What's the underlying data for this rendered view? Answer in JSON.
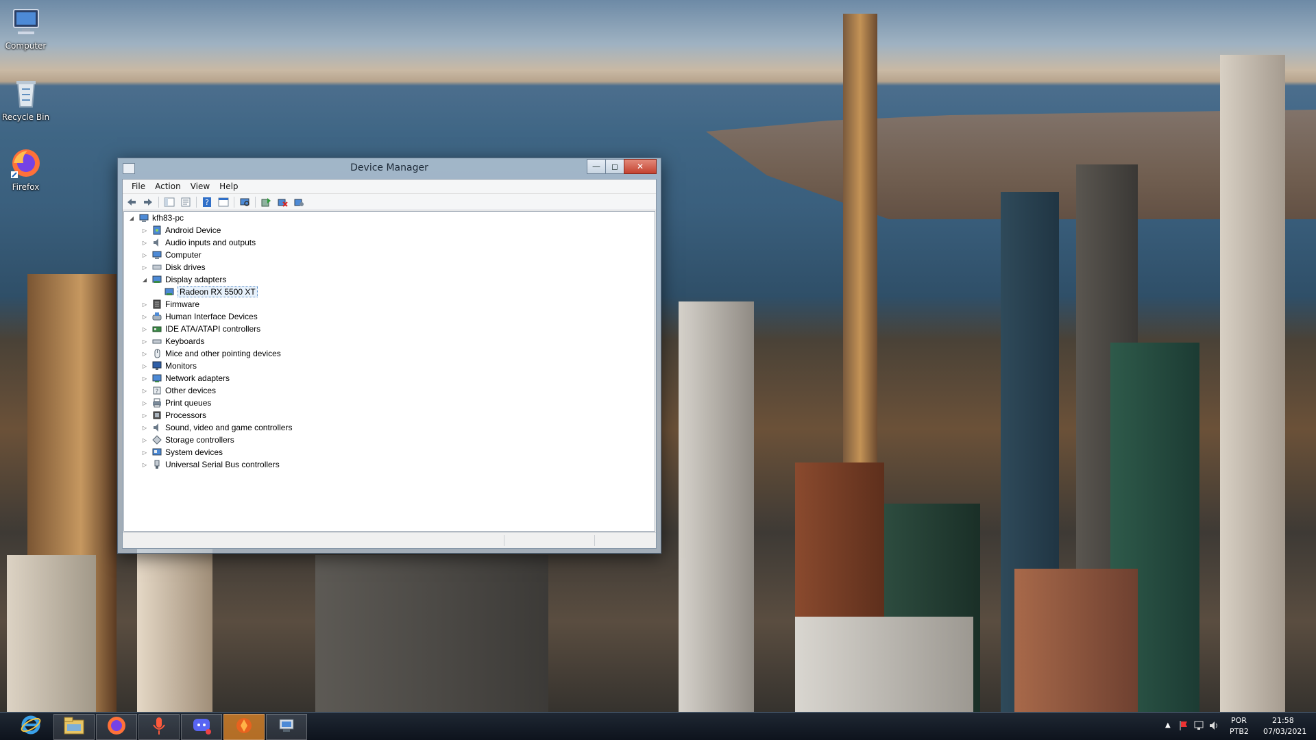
{
  "desktop": {
    "icons": [
      {
        "label": "Computer",
        "icon": "computer-icon"
      },
      {
        "label": "Recycle Bin",
        "icon": "recycle-bin-icon"
      },
      {
        "label": "Firefox",
        "icon": "firefox-icon"
      }
    ]
  },
  "window": {
    "title": "Device Manager",
    "menu": [
      "File",
      "Action",
      "View",
      "Help"
    ],
    "toolbar": [
      "back-icon",
      "forward-icon",
      "show-hide-console-tree-icon",
      "properties-icon",
      "help-icon",
      "show-details-icon",
      "scan-hardware-icon",
      "update-driver-icon",
      "uninstall-device-icon",
      "enable-device-icon"
    ],
    "tree": {
      "root": "kfh83-pc",
      "items": [
        {
          "label": "Android Device",
          "icon": "android-device-icon",
          "expanded": false
        },
        {
          "label": "Audio inputs and outputs",
          "icon": "speaker-icon",
          "expanded": false
        },
        {
          "label": "Computer",
          "icon": "computer-icon",
          "expanded": false
        },
        {
          "label": "Disk drives",
          "icon": "disk-drive-icon",
          "expanded": false
        },
        {
          "label": "Display adapters",
          "icon": "display-adapter-icon",
          "expanded": true
        },
        {
          "label": "Radeon RX 5500 XT",
          "icon": "display-adapter-icon",
          "child": true,
          "selected": true
        },
        {
          "label": "Firmware",
          "icon": "firmware-icon",
          "expanded": false
        },
        {
          "label": "Human Interface Devices",
          "icon": "hid-icon",
          "expanded": false
        },
        {
          "label": "IDE ATA/ATAPI controllers",
          "icon": "ide-controller-icon",
          "expanded": false
        },
        {
          "label": "Keyboards",
          "icon": "keyboard-icon",
          "expanded": false
        },
        {
          "label": "Mice and other pointing devices",
          "icon": "mouse-icon",
          "expanded": false
        },
        {
          "label": "Monitors",
          "icon": "monitor-icon",
          "expanded": false
        },
        {
          "label": "Network adapters",
          "icon": "network-adapter-icon",
          "expanded": false
        },
        {
          "label": "Other devices",
          "icon": "other-devices-icon",
          "expanded": false
        },
        {
          "label": "Print queues",
          "icon": "printer-icon",
          "expanded": false
        },
        {
          "label": "Processors",
          "icon": "processor-icon",
          "expanded": false
        },
        {
          "label": "Sound, video and game controllers",
          "icon": "speaker-icon",
          "expanded": false
        },
        {
          "label": "Storage controllers",
          "icon": "storage-controller-icon",
          "expanded": false
        },
        {
          "label": "System devices",
          "icon": "system-devices-icon",
          "expanded": false
        },
        {
          "label": "Universal Serial Bus controllers",
          "icon": "usb-icon",
          "expanded": false
        }
      ]
    }
  },
  "taskbar": {
    "apps": [
      "internet-explorer-icon",
      "file-explorer-icon",
      "firefox-icon",
      "microphone-app-icon",
      "discord-icon",
      "orange-app-icon",
      "device-manager-icon"
    ],
    "tray": {
      "lang_top": "POR",
      "lang_bottom": "PTB2",
      "time": "21:58",
      "date": "07/03/2021"
    }
  }
}
